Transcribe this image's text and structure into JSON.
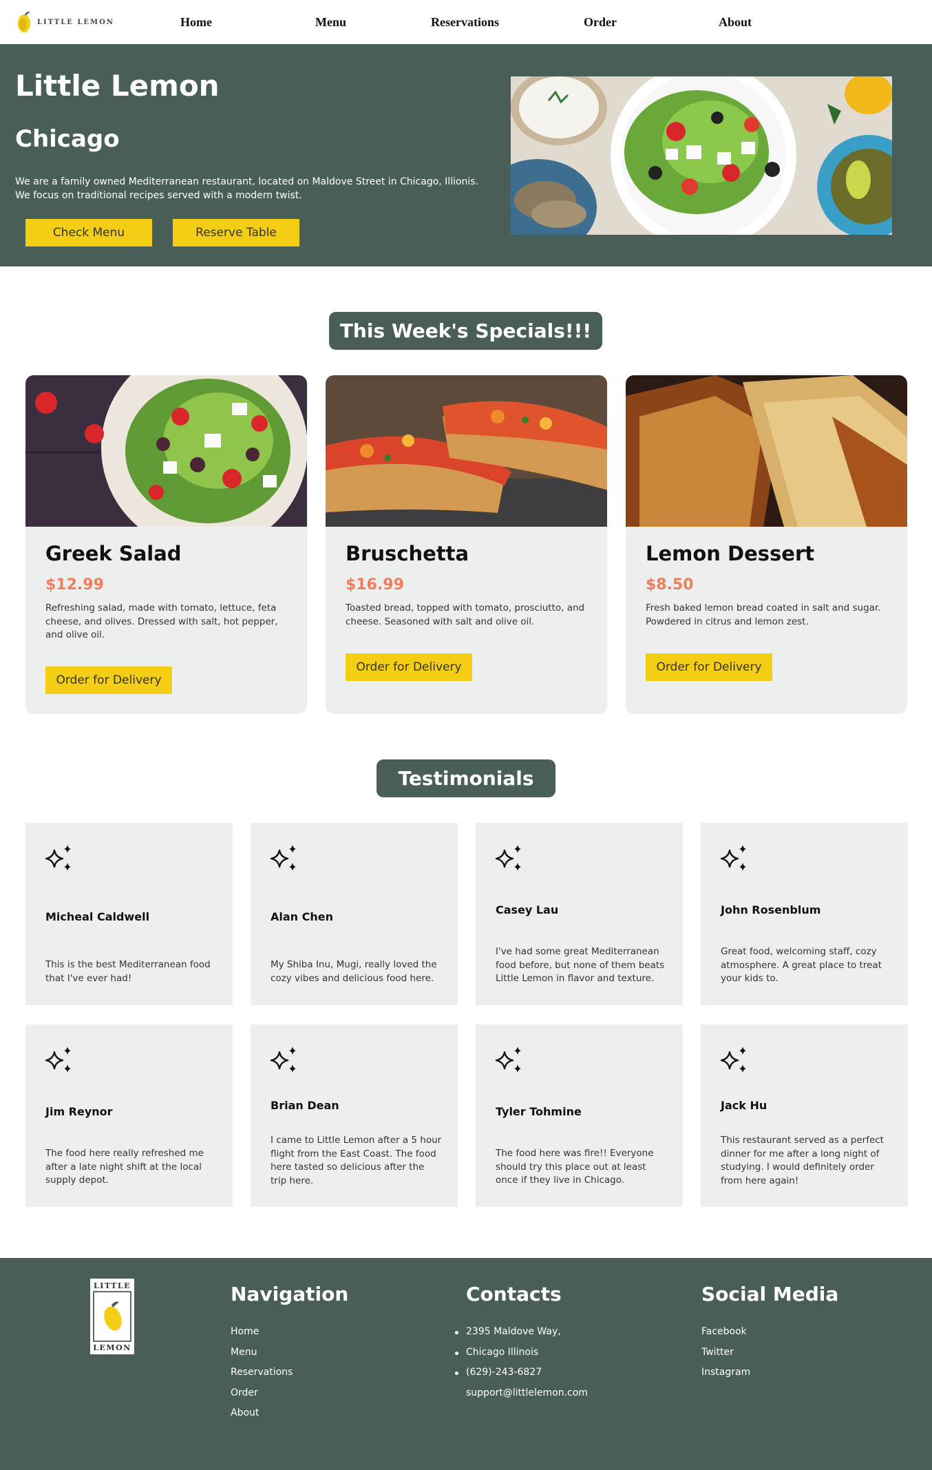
{
  "nav": {
    "logo_text": "LITTLE LEMON",
    "links": [
      "Home",
      "Menu",
      "Reservations",
      "Order",
      "About"
    ]
  },
  "hero": {
    "title": "Little Lemon",
    "subtitle": "Chicago",
    "description": "We are a family owned Mediterranean restaurant, located on Maldove Street in Chicago, Illionis. We focus on traditional recipes served with a modern twist.",
    "check_menu": "Check Menu",
    "reserve_table": "Reserve Table"
  },
  "specials": {
    "heading": "This Week's Specials!!!",
    "items": [
      {
        "name": "Greek Salad",
        "price": "$12.99",
        "description": "Refreshing salad, made with tomato, lettuce, feta cheese, and olives. Dressed with salt, hot pepper, and olive oil.",
        "button": "Order for Delivery"
      },
      {
        "name": "Bruschetta",
        "price": "$16.99",
        "description": "Toasted bread, topped with tomato, prosciutto, and cheese. Seasoned with salt and olive oil.",
        "button": "Order for Delivery"
      },
      {
        "name": "Lemon Dessert",
        "price": "$8.50",
        "description": "Fresh baked lemon bread coated in salt and sugar. Powdered in citrus and lemon zest.",
        "button": "Order for Delivery"
      }
    ]
  },
  "testimonials": {
    "heading": "Testimonials",
    "items": [
      {
        "name": "Micheal Caldwell",
        "text": "This is the best Mediterranean food that I've ever had!"
      },
      {
        "name": "Alan Chen",
        "text": "My Shiba Inu, Mugi, really loved the cozy vibes and delicious food here."
      },
      {
        "name": "Casey Lau",
        "text": "I've had some great Mediterranean food before, but none of them beats Little Lemon in flavor and texture."
      },
      {
        "name": "John Rosenblum",
        "text": "Great food, welcoming staff, cozy atmosphere. A great place to treat your kids to."
      },
      {
        "name": "Jim Reynor",
        "text": "The food here really refreshed me after a late night shift at the local supply depot."
      },
      {
        "name": "Brian Dean",
        "text": "I came to Little Lemon after a 5 hour flight from the East Coast. The food here tasted so delicious after the trip here."
      },
      {
        "name": "Tyler Tohmine",
        "text": "The food here was fire!! Everyone should try this place out at least once if they live in Chicago."
      },
      {
        "name": "Jack Hu",
        "text": "This restaurant served as a perfect dinner for me after a long night of studying. I would definitely order from here again!"
      }
    ]
  },
  "footer": {
    "logo_top": "LITTLE",
    "logo_bottom": "LEMON",
    "navigation": {
      "heading": "Navigation",
      "links": [
        "Home",
        "Menu",
        "Reservations",
        "Order",
        "About"
      ]
    },
    "contacts": {
      "heading": "Contacts",
      "items": [
        "2395 Maldove Way,",
        "Chicago Illinois",
        "(629)-243-6827",
        "support@littlelemon.com"
      ]
    },
    "social": {
      "heading": "Social Media",
      "links": [
        "Facebook",
        "Twitter",
        "Instagram"
      ]
    }
  },
  "colors": {
    "primary": "#495e57",
    "accent_yellow": "#f4ce14",
    "price": "#ee7f5a",
    "card_bg": "#edefee"
  }
}
